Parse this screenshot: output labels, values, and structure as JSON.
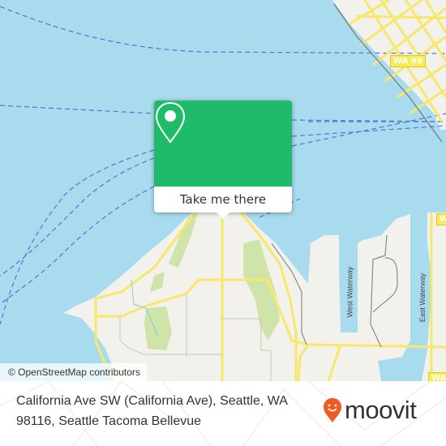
{
  "map": {
    "attribution": "© OpenStreetMap contributors",
    "labels": {
      "west_waterway": "West Waterway",
      "east_waterway": "East Waterway"
    },
    "shields": {
      "wa99": "WA 99",
      "wa_right": "WA",
      "wa_bottom": "WA"
    },
    "colors": {
      "water": "#a9dbef",
      "land": "#f2f1ec",
      "road": "#f7e86a",
      "park": "#cfe4a9",
      "ferry": "#5b6fd8"
    }
  },
  "popup": {
    "icon": "map-pin-icon",
    "button_label": "Take me there",
    "color": "#1fba6a"
  },
  "footer": {
    "address_line1": "California Ave SW (California Ave), Seattle, WA",
    "address_line2": "98116, Seattle Tacoma Bellevue",
    "brand": "moovit",
    "brand_icon": "moovit-face-pin-icon",
    "brand_color": "#f15a24"
  }
}
